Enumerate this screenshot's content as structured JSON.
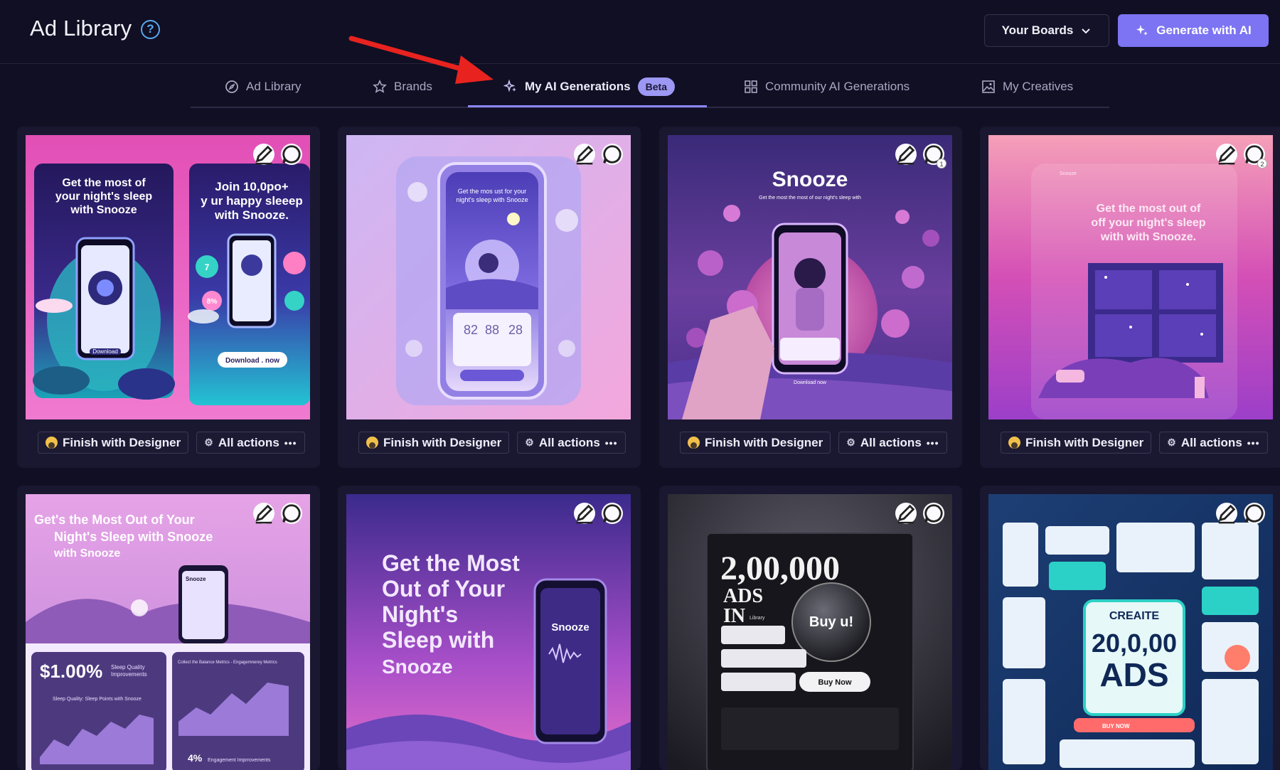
{
  "header": {
    "title": "Ad Library",
    "help_icon": "question-circle-icon",
    "boards_label": "Your Boards",
    "generate_label": "Generate with AI"
  },
  "tabs": [
    {
      "label": "Ad Library",
      "icon": "compass-icon"
    },
    {
      "label": "Brands",
      "icon": "star-icon"
    },
    {
      "label": "My AI Generations",
      "icon": "sparkle-icon",
      "badge": "Beta",
      "active": true
    },
    {
      "label": "Community AI Generations",
      "icon": "grid-icon"
    },
    {
      "label": "My Creatives",
      "icon": "image-icon"
    }
  ],
  "card_actions": {
    "finish_label": "Finish with Designer",
    "all_actions_label": "All actions"
  },
  "cards": [
    {
      "texts": [
        "Get the most of",
        "your night's sleep",
        "with Snooze",
        "Join 10,0po+",
        "y ur happy sleeep",
        "with Snooze.",
        "Download",
        "Download . now",
        "7",
        "8%"
      ],
      "comment_count": ""
    },
    {
      "texts": [
        "Get the mos ust for your",
        "night's sleep with Snooze",
        "82",
        "88",
        "28"
      ],
      "comment_count": ""
    },
    {
      "texts": [
        "Snooze",
        "Get the most the most of our night's sleep with",
        "Download now"
      ],
      "comment_count": "1"
    },
    {
      "texts": [
        "Snooze",
        "Get the most out of",
        "off your night's sleep",
        "with with Snooze."
      ],
      "comment_count": "2"
    },
    {
      "texts": [
        "Get's the Most Out of Your",
        "Night's Sleep with Snooze",
        "with Snooze",
        "Snooze",
        "$1.00%",
        "Sleep Quality",
        "Improvements",
        "Collect the Balance Metrics - Engagemnerey Metrics",
        "Sleep Quality: Sleep Points with Snooze",
        "4%",
        "Engagement Imprrovements"
      ],
      "comment_count": ""
    },
    {
      "texts": [
        "Get the Most",
        "Out of Your",
        "Night's",
        "Sleep with",
        "Snooze",
        "Snooze"
      ],
      "comment_count": ""
    },
    {
      "texts": [
        "2,00,000",
        "ADS",
        "IN",
        "Library",
        "Buy u!",
        "Buy Now"
      ],
      "comment_count": ""
    },
    {
      "texts": [
        "CREAITE",
        "20,0,00",
        "ADS",
        "BUY NOW"
      ],
      "comment_count": ""
    }
  ]
}
